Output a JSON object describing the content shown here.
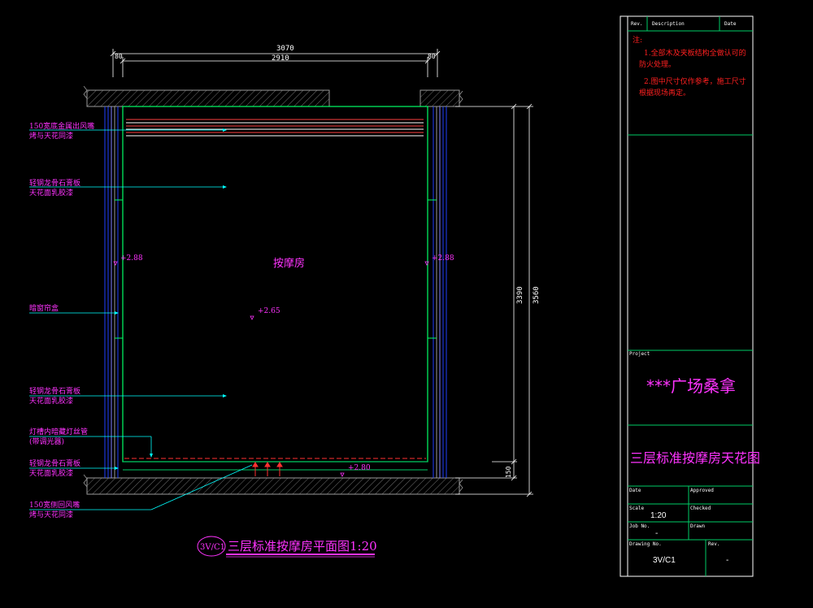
{
  "colors": {
    "background": "#000000",
    "wall_line": "#9a9a9a",
    "room_outline": "#00ff66",
    "annotation": "#ff33ff",
    "leader": "#00ffff",
    "dimension": "#ffffff",
    "title_block": "#00cc66",
    "notes": "#ff2020"
  },
  "drawing": {
    "room_label": "按摩房",
    "dimensions": {
      "top_total": "3070",
      "top_inner": "2910",
      "top_left_offset": "80",
      "top_right_offset": "80",
      "right_inner": "3390",
      "right_total": "3560",
      "right_bottom": "150"
    },
    "levels": {
      "left": "+2.88",
      "right": "+2.88",
      "center": "+2.65",
      "bottom": "+2.80"
    },
    "annotations": [
      {
        "line1": "150宽底金属出风嘴",
        "line2": "烤与天花同漆"
      },
      {
        "line1": "轻钢龙骨石膏板",
        "line2": "天花面乳胶漆"
      },
      {
        "line1": "暗窗帘盒",
        "line2": ""
      },
      {
        "line1": "轻钢龙骨石膏板",
        "line2": "天花面乳胶漆"
      },
      {
        "line1": "灯槽内暗藏灯丝管",
        "line2": "(带调光器)"
      },
      {
        "line1": "轻钢龙骨石膏板",
        "line2": "天花面乳胶漆"
      },
      {
        "line1": "150宽侧回风嘴",
        "line2": "烤与天花同漆"
      }
    ],
    "caption": {
      "ref": "3V/C1",
      "title": "三层标准按摩房平面图1:20"
    }
  },
  "title_block": {
    "rev_header": {
      "rev": "Rev.",
      "description": "Description",
      "date": "Date"
    },
    "notes_title": "注:",
    "notes": [
      "1.全部木及夹板结构全做认可的",
      "防火处理。",
      "2.图中尺寸仅作参考，施工尺寸",
      "根据现场再定。"
    ],
    "project_label": "Project",
    "project_name": "***广场桑拿",
    "drawing_title": "三层标准按摩房天花图",
    "fields": {
      "date_label": "Date",
      "approved_label": "Approved",
      "scale_label": "Scale",
      "scale_value": "1:20",
      "checked_label": "Checked",
      "job_label": "Job No.",
      "job_value": "-",
      "drawn_label": "Drawn",
      "drawing_no_label": "Drawing No.",
      "drawing_no_value": "3V/C1",
      "rev_label": "Rev.",
      "rev_value": "-"
    }
  }
}
